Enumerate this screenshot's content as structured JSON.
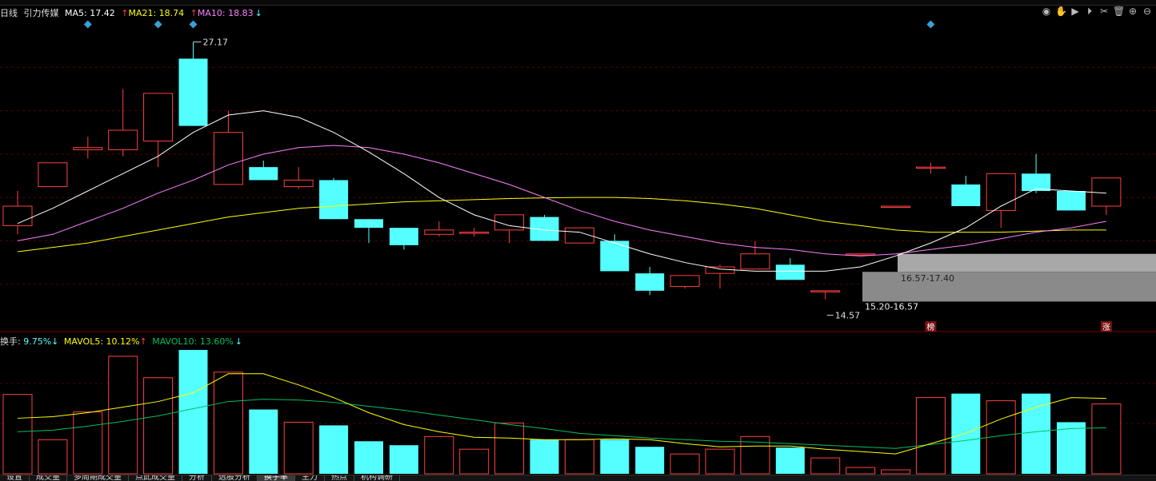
{
  "header": {
    "period": "日线",
    "stock_name": "引力传媒",
    "ma5_label": "MA5:",
    "ma5_value": "17.42",
    "ma21_label": "MA21:",
    "ma21_value": "18.74",
    "ma10_label": "MA10:",
    "ma10_value": "18.83",
    "ma5_color": "#ffffff",
    "ma21_color": "#ffff00",
    "ma10_color": "#ff80ff"
  },
  "volume_header": {
    "turnover_label": "换手:",
    "turnover_value": "9.75%",
    "mavol5_label": "MAVOL5:",
    "mavol5_value": "10.12%",
    "mavol10_label": "MAVOL10:",
    "mavol10_value": "13.60%"
  },
  "annotations": {
    "high_price": "27.17",
    "low_price": "14.57",
    "zone_upper": "16.57-17.40",
    "zone_lower": "15.20-16.57",
    "badge_rank": "榜",
    "badge_limit_up": "涨"
  },
  "toolbar_icons": [
    "eye-icon",
    "hand-icon",
    "play-icon",
    "play-icon",
    "scissors-icon",
    "trash-icon",
    "zoom-in-icon",
    "zoom-out-icon"
  ],
  "bottom_tabs": [
    "设置",
    "成交量",
    "多周期成交量",
    "点此成交量",
    "分析",
    "选股分析",
    "换手率",
    "主力",
    "热点",
    "机构调研"
  ],
  "colors": {
    "up": "#ff4040",
    "down": "#54ffff",
    "ma5": "#ffffff",
    "ma10": "#ff80ff",
    "ma21": "#ffff00",
    "mavol10": "#00c060"
  },
  "chart_data": {
    "type": "candlestick",
    "price_range": [
      14.0,
      28.0
    ],
    "candles": [
      {
        "o": 18.7,
        "c": 19.6,
        "h": 20.3,
        "l": 18.3,
        "dir": "up"
      },
      {
        "o": 20.5,
        "c": 21.6,
        "h": 21.6,
        "l": 20.5,
        "dir": "up"
      },
      {
        "o": 22.2,
        "c": 22.3,
        "h": 22.8,
        "l": 21.8,
        "dir": "up"
      },
      {
        "o": 22.2,
        "c": 23.1,
        "h": 25.0,
        "l": 21.9,
        "dir": "up"
      },
      {
        "o": 22.6,
        "c": 24.8,
        "h": 24.8,
        "l": 21.4,
        "dir": "up"
      },
      {
        "o": 23.3,
        "c": 26.4,
        "h": 27.17,
        "l": 23.3,
        "dir": "down"
      },
      {
        "o": 20.6,
        "c": 23.0,
        "h": 24.0,
        "l": 20.6,
        "dir": "up"
      },
      {
        "o": 21.4,
        "c": 20.8,
        "h": 21.7,
        "l": 20.8,
        "dir": "down"
      },
      {
        "o": 20.5,
        "c": 20.8,
        "h": 21.4,
        "l": 20.4,
        "dir": "up"
      },
      {
        "o": 20.8,
        "c": 19.0,
        "h": 20.9,
        "l": 19.0,
        "dir": "down"
      },
      {
        "o": 19.0,
        "c": 18.6,
        "h": 19.0,
        "l": 17.9,
        "dir": "down"
      },
      {
        "o": 18.6,
        "c": 17.8,
        "h": 18.6,
        "l": 17.6,
        "dir": "down"
      },
      {
        "o": 18.3,
        "c": 18.5,
        "h": 18.9,
        "l": 18.2,
        "dir": "up"
      },
      {
        "o": 18.4,
        "c": 18.4,
        "h": 18.6,
        "l": 18.2,
        "dir": "up"
      },
      {
        "o": 18.5,
        "c": 19.2,
        "h": 19.2,
        "l": 17.9,
        "dir": "up"
      },
      {
        "o": 19.1,
        "c": 18.0,
        "h": 19.2,
        "l": 18.0,
        "dir": "down"
      },
      {
        "o": 17.9,
        "c": 18.6,
        "h": 18.6,
        "l": 17.9,
        "dir": "up"
      },
      {
        "o": 18.0,
        "c": 16.6,
        "h": 18.3,
        "l": 16.6,
        "dir": "down"
      },
      {
        "o": 16.5,
        "c": 15.7,
        "h": 16.8,
        "l": 15.5,
        "dir": "down"
      },
      {
        "o": 15.9,
        "c": 16.4,
        "h": 16.4,
        "l": 15.8,
        "dir": "up"
      },
      {
        "o": 16.5,
        "c": 16.8,
        "h": 16.9,
        "l": 15.8,
        "dir": "up"
      },
      {
        "o": 16.7,
        "c": 17.4,
        "h": 18.0,
        "l": 16.7,
        "dir": "up"
      },
      {
        "o": 16.9,
        "c": 16.2,
        "h": 17.2,
        "l": 16.2,
        "dir": "down"
      },
      {
        "o": 15.7,
        "c": 15.7,
        "h": 15.7,
        "l": 15.3,
        "dir": "up"
      },
      {
        "o": 17.4,
        "c": 17.4,
        "h": 17.4,
        "l": 17.4,
        "dir": "up"
      },
      {
        "o": 19.6,
        "c": 19.6,
        "h": 19.6,
        "l": 19.6,
        "dir": "up"
      },
      {
        "o": 21.4,
        "c": 21.4,
        "h": 21.6,
        "l": 21.1,
        "dir": "up"
      },
      {
        "o": 20.6,
        "c": 19.6,
        "h": 21.0,
        "l": 19.6,
        "dir": "down"
      },
      {
        "o": 19.4,
        "c": 21.1,
        "h": 21.1,
        "l": 18.6,
        "dir": "up"
      },
      {
        "o": 21.1,
        "c": 20.3,
        "h": 22.0,
        "l": 20.2,
        "dir": "down"
      },
      {
        "o": 20.3,
        "c": 19.4,
        "h": 20.3,
        "l": 19.4,
        "dir": "down"
      },
      {
        "o": 19.6,
        "c": 20.9,
        "h": 20.9,
        "l": 19.2,
        "dir": "up"
      }
    ],
    "ma5": [
      18.8,
      19.5,
      20.3,
      21.1,
      21.9,
      23.0,
      23.8,
      24.0,
      23.7,
      23.0,
      22.1,
      21.1,
      20.0,
      19.2,
      18.7,
      18.5,
      18.4,
      17.9,
      17.4,
      17.0,
      16.7,
      16.6,
      16.6,
      16.6,
      16.8,
      17.3,
      17.9,
      18.6,
      19.6,
      20.4,
      20.3,
      20.2
    ],
    "ma10": [
      18.0,
      18.3,
      18.9,
      19.5,
      20.2,
      20.8,
      21.5,
      22.0,
      22.3,
      22.4,
      22.3,
      22.0,
      21.6,
      21.1,
      20.6,
      20.0,
      19.4,
      18.9,
      18.5,
      18.2,
      17.9,
      17.7,
      17.6,
      17.4,
      17.3,
      17.4,
      17.6,
      17.8,
      18.1,
      18.4,
      18.6,
      18.9
    ],
    "ma21": [
      17.5,
      17.7,
      17.9,
      18.2,
      18.5,
      18.8,
      19.1,
      19.3,
      19.5,
      19.6,
      19.7,
      19.8,
      19.85,
      19.9,
      19.95,
      19.98,
      20.0,
      20.0,
      19.95,
      19.85,
      19.7,
      19.5,
      19.2,
      18.9,
      18.7,
      18.5,
      18.4,
      18.4,
      18.4,
      18.45,
      18.5,
      18.5
    ],
    "volume": [
      {
        "v": 10.0,
        "dir": "up"
      },
      {
        "v": 4.3,
        "dir": "up"
      },
      {
        "v": 7.8,
        "dir": "up"
      },
      {
        "v": 14.8,
        "dir": "up"
      },
      {
        "v": 12.1,
        "dir": "up"
      },
      {
        "v": 15.6,
        "dir": "down"
      },
      {
        "v": 12.8,
        "dir": "up"
      },
      {
        "v": 8.1,
        "dir": "down"
      },
      {
        "v": 6.5,
        "dir": "up"
      },
      {
        "v": 6.1,
        "dir": "down"
      },
      {
        "v": 4.1,
        "dir": "down"
      },
      {
        "v": 3.6,
        "dir": "down"
      },
      {
        "v": 4.7,
        "dir": "up"
      },
      {
        "v": 3.1,
        "dir": "up"
      },
      {
        "v": 6.4,
        "dir": "up"
      },
      {
        "v": 4.3,
        "dir": "down"
      },
      {
        "v": 4.3,
        "dir": "up"
      },
      {
        "v": 4.3,
        "dir": "down"
      },
      {
        "v": 3.4,
        "dir": "down"
      },
      {
        "v": 2.5,
        "dir": "up"
      },
      {
        "v": 3.1,
        "dir": "up"
      },
      {
        "v": 4.7,
        "dir": "up"
      },
      {
        "v": 3.3,
        "dir": "down"
      },
      {
        "v": 2.0,
        "dir": "up"
      },
      {
        "v": 0.8,
        "dir": "up"
      },
      {
        "v": 0.5,
        "dir": "up"
      },
      {
        "v": 9.6,
        "dir": "up"
      },
      {
        "v": 10.1,
        "dir": "down"
      },
      {
        "v": 9.2,
        "dir": "up"
      },
      {
        "v": 10.1,
        "dir": "down"
      },
      {
        "v": 6.5,
        "dir": "down"
      },
      {
        "v": 8.8,
        "dir": "up"
      }
    ],
    "mavol5": [
      7.0,
      7.2,
      7.7,
      8.4,
      9.1,
      10.2,
      12.6,
      12.6,
      11.2,
      9.6,
      7.7,
      6.2,
      5.3,
      4.6,
      4.5,
      4.3,
      4.3,
      4.4,
      4.3,
      3.8,
      3.4,
      3.5,
      3.5,
      3.1,
      2.8,
      2.5,
      3.8,
      5.1,
      6.9,
      8.4,
      9.6,
      9.5
    ],
    "mavol10": [
      5.3,
      5.5,
      6.0,
      6.6,
      7.3,
      8.2,
      9.1,
      9.4,
      9.3,
      9.0,
      8.5,
      8.0,
      7.4,
      6.8,
      6.2,
      5.7,
      5.1,
      4.8,
      4.5,
      4.3,
      4.1,
      4.0,
      3.8,
      3.6,
      3.4,
      3.2,
      3.7,
      4.2,
      4.8,
      5.3,
      5.7,
      5.8
    ],
    "vol_range": [
      0,
      16
    ]
  }
}
